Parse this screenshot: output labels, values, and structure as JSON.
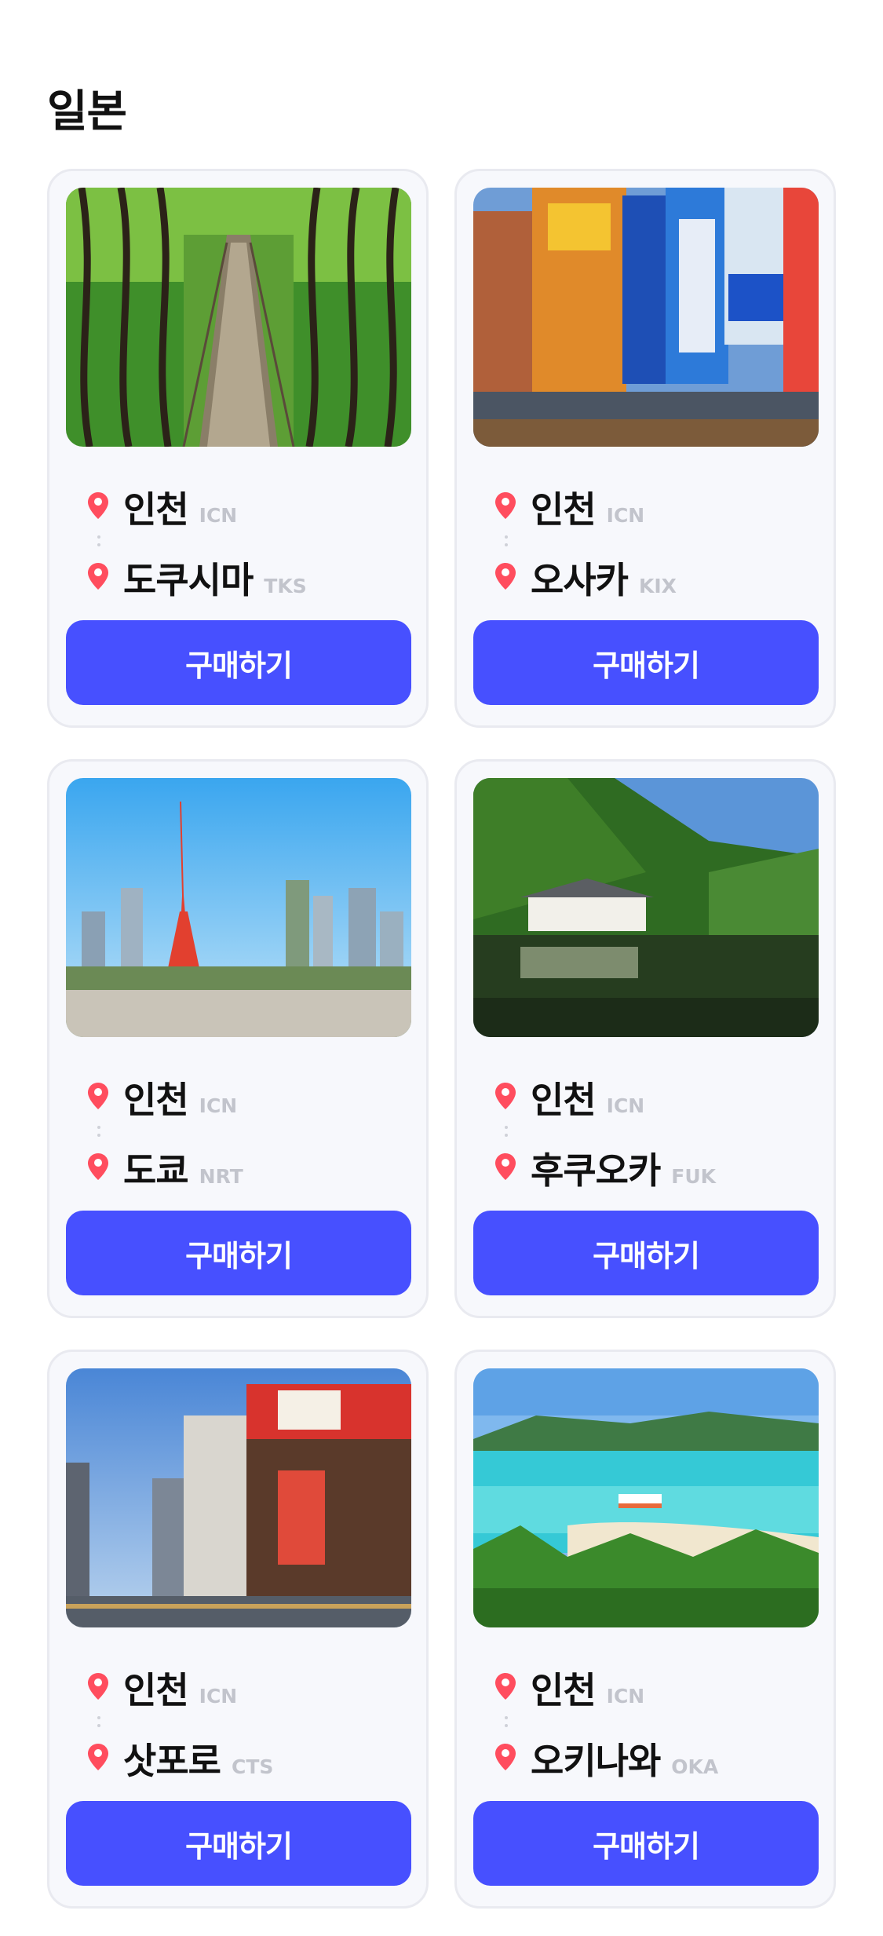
{
  "section": {
    "title": "일본"
  },
  "colors": {
    "accent": "#4750ff",
    "pin": "#ff4d5e",
    "code_gray": "#c2c4cc"
  },
  "cards": [
    {
      "photo": "bridge-forest-photo",
      "origin": {
        "city": "인천",
        "code": "ICN"
      },
      "dest": {
        "city": "도쿠시마",
        "code": "TKS"
      },
      "button": "구매하기"
    },
    {
      "photo": "city-billboards-photo",
      "origin": {
        "city": "인천",
        "code": "ICN"
      },
      "dest": {
        "city": "오사카",
        "code": "KIX"
      },
      "button": "구매하기"
    },
    {
      "photo": "tokyo-tower-photo",
      "origin": {
        "city": "인천",
        "code": "ICN"
      },
      "dest": {
        "city": "도쿄",
        "code": "NRT"
      },
      "button": "구매하기"
    },
    {
      "photo": "lake-forest-photo",
      "origin": {
        "city": "인천",
        "code": "ICN"
      },
      "dest": {
        "city": "후쿠오카",
        "code": "FUK"
      },
      "button": "구매하기"
    },
    {
      "photo": "city-intersection-photo",
      "origin": {
        "city": "인천",
        "code": "ICN"
      },
      "dest": {
        "city": "삿포로",
        "code": "CTS"
      },
      "button": "구매하기"
    },
    {
      "photo": "tropical-beach-photo",
      "origin": {
        "city": "인천",
        "code": "ICN"
      },
      "dest": {
        "city": "오키나와",
        "code": "OKA"
      },
      "button": "구매하기"
    }
  ]
}
